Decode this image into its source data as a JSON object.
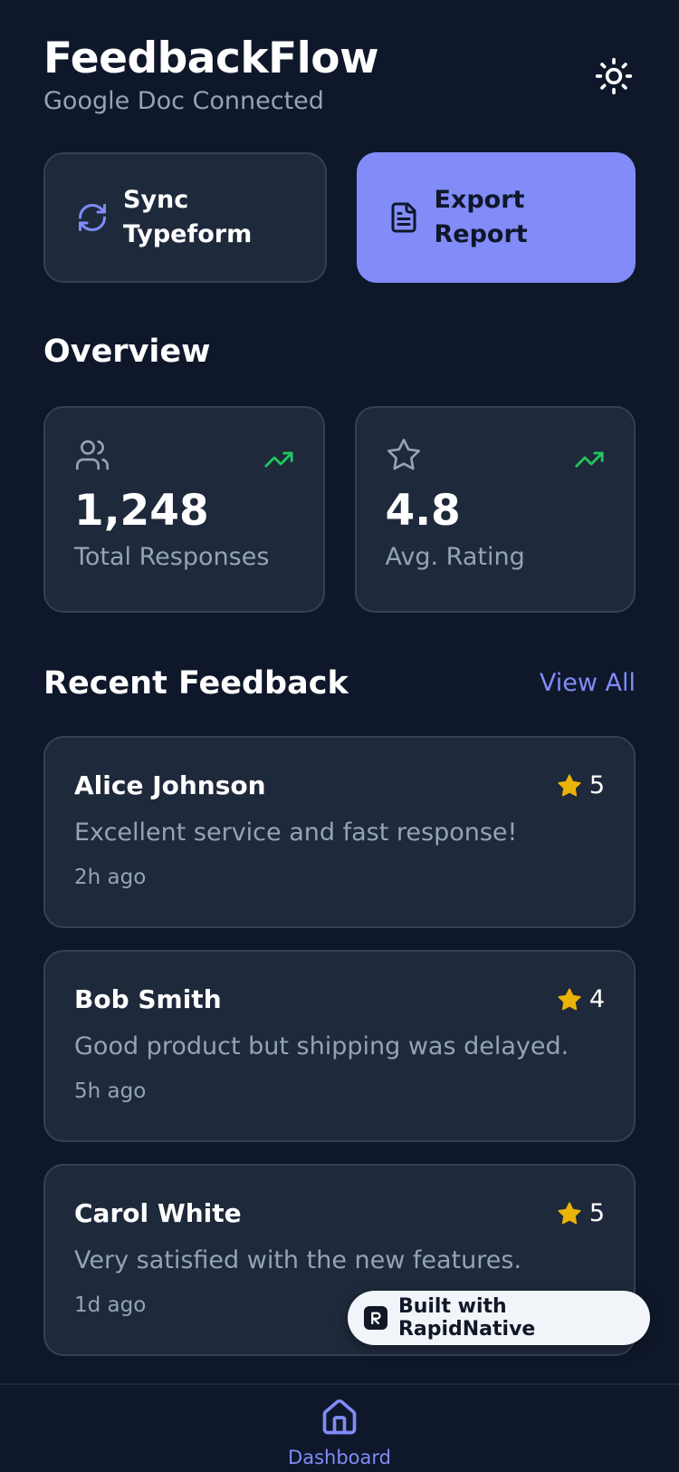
{
  "colors": {
    "background": "#0f172a",
    "card": "#1e293b",
    "border": "#334155",
    "accent": "#818cf8",
    "muted_text": "#94a3b8",
    "trend_green": "#22c55e",
    "star_yellow": "#eab308"
  },
  "header": {
    "title": "FeedbackFlow",
    "subtitle": "Google Doc Connected",
    "theme_icon": "sun-icon"
  },
  "actions": [
    {
      "label": "Sync Typeform",
      "icon": "refresh-icon"
    },
    {
      "label": "Export Report",
      "icon": "file-text-icon"
    }
  ],
  "overview": {
    "title": "Overview",
    "stats": [
      {
        "value": "1,248",
        "label": "Total Responses",
        "icon": "users-icon",
        "trend_icon": "trending-up-icon"
      },
      {
        "value": "4.8",
        "label": "Avg. Rating",
        "icon": "star-outline-icon",
        "trend_icon": "trending-up-icon"
      }
    ]
  },
  "recent": {
    "title": "Recent Feedback",
    "view_all": "View All",
    "items": [
      {
        "name": "Alice Johnson",
        "rating": "5",
        "message": "Excellent service and fast response!",
        "time": "2h ago"
      },
      {
        "name": "Bob Smith",
        "rating": "4",
        "message": "Good product but shipping was delayed.",
        "time": "5h ago"
      },
      {
        "name": "Carol White",
        "rating": "5",
        "message": "Very satisfied with the new features.",
        "time": "1d ago"
      }
    ]
  },
  "badge": {
    "text": "Built with RapidNative",
    "logo_letter": "R"
  },
  "nav": {
    "items": [
      {
        "label": "Dashboard",
        "icon": "home-icon",
        "active": true
      }
    ]
  }
}
